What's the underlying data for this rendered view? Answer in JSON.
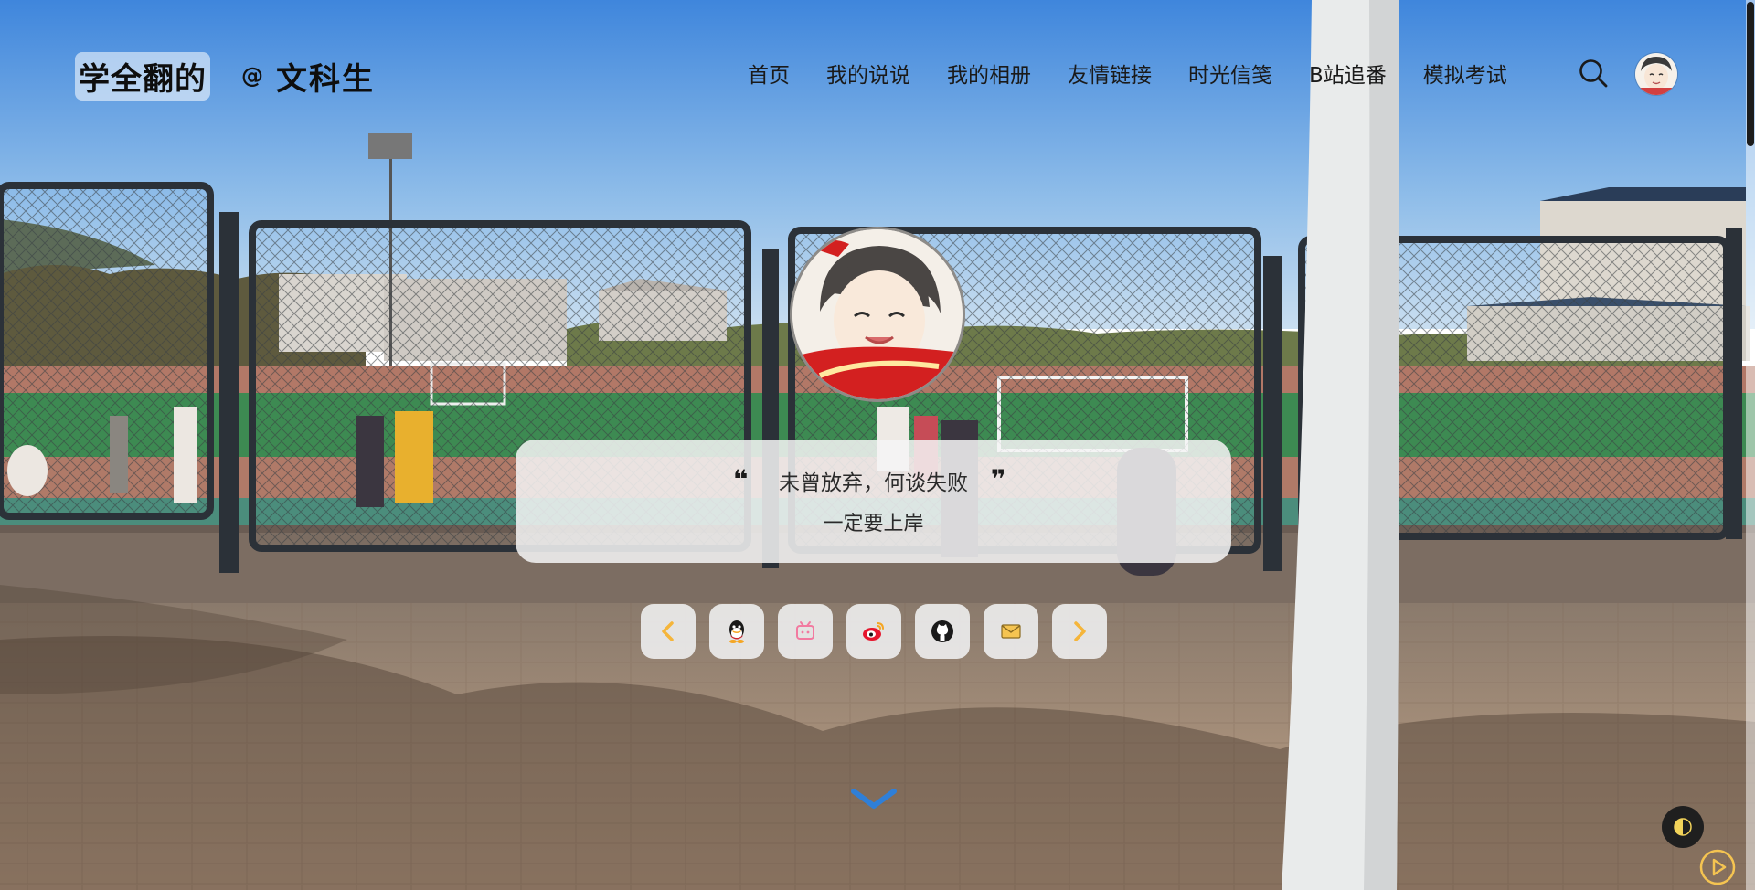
{
  "brand": {
    "name": "学全翻的",
    "at": "@",
    "role": "文科生"
  },
  "nav": {
    "items": [
      "首页",
      "我的说说",
      "我的相册",
      "友情链接",
      "时光信笺",
      "B站追番",
      "模拟考试"
    ]
  },
  "quote": {
    "open_mark": "❝",
    "text": "未曾放弃，何谈失败",
    "close_mark": "❞",
    "subtitle": "一定要上岸"
  },
  "social": {
    "buttons": [
      "prev-chevron-icon",
      "qq-icon",
      "bilibili-icon",
      "weibo-icon",
      "github-icon",
      "email-icon",
      "next-chevron-icon"
    ]
  },
  "colors": {
    "accent_orange": "#f5b53a",
    "chevron_blue": "#2f7fd8",
    "card_bg": "#f5f5f5"
  }
}
